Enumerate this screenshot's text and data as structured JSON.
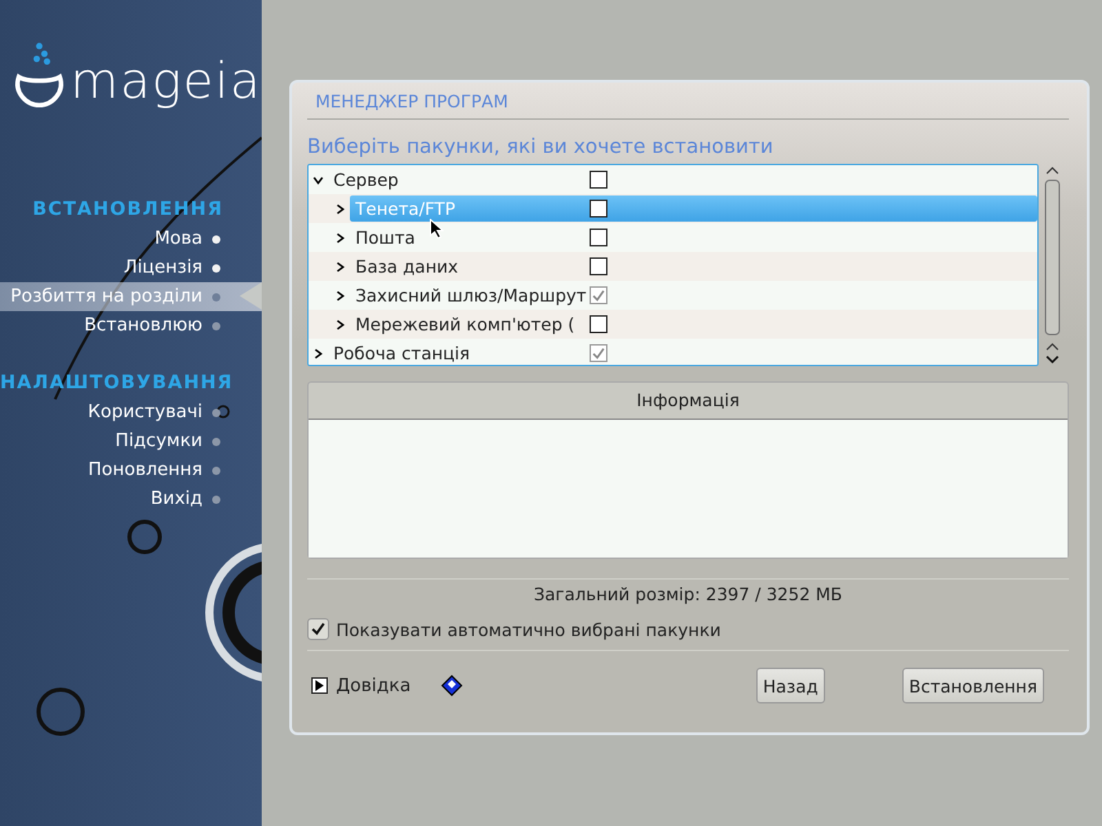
{
  "sidebar": {
    "logo": "mageia",
    "sections": [
      {
        "title": "ВСТАНОВЛЕННЯ",
        "steps": [
          {
            "label": "Мова",
            "selected": false,
            "done": true
          },
          {
            "label": "Ліцензія",
            "selected": false,
            "done": true
          },
          {
            "label": "Розбиття на розділи",
            "selected": true,
            "done": false
          },
          {
            "label": "Встановлюю",
            "selected": false,
            "done": false
          }
        ]
      },
      {
        "title": "НАЛАШТОВУВАННЯ",
        "steps": [
          {
            "label": "Користувачі",
            "selected": false,
            "done": false
          },
          {
            "label": "Підсумки",
            "selected": false,
            "done": false
          },
          {
            "label": "Поновлення",
            "selected": false,
            "done": false
          },
          {
            "label": "Вихід",
            "selected": false,
            "done": false
          }
        ]
      }
    ]
  },
  "panel": {
    "title": "МЕНЕДЖЕР ПРОГРАМ",
    "prompt": "Виберіть пакунки, які ви хочете встановити",
    "tree": [
      {
        "label": "Сервер",
        "checked": false,
        "expanded": true,
        "selected": false,
        "children": [
          {
            "label": "Тенета/FTP",
            "checked": false,
            "expanded": false,
            "selected": true
          },
          {
            "label": "Пошта",
            "checked": false,
            "expanded": false,
            "selected": false
          },
          {
            "label": "База даних",
            "checked": false,
            "expanded": false,
            "selected": false
          },
          {
            "label": "Захисний шлюз/Маршрут",
            "checked": true,
            "expanded": false,
            "selected": false
          },
          {
            "label": "Мережевий комп'ютер (",
            "checked": false,
            "expanded": false,
            "selected": false
          }
        ]
      },
      {
        "label": "Робоча станція",
        "checked": true,
        "expanded": false,
        "selected": false
      }
    ],
    "info": {
      "title": "Інформація"
    },
    "total_size": "Загальний розмір: 2397 / 3252 МБ",
    "show_auto": {
      "label": "Показувати автоматично вибрані пакунки",
      "checked": true
    },
    "help": {
      "label": "Довідка",
      "expanded": false
    },
    "buttons": [
      "Назад",
      "Встановлення"
    ]
  }
}
